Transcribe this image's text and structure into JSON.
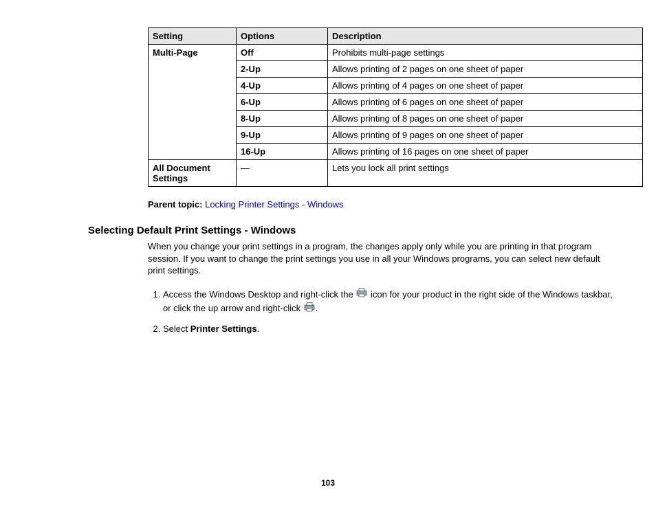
{
  "table": {
    "headers": [
      "Setting",
      "Options",
      "Description"
    ],
    "rows": [
      {
        "setting": "Multi-Page",
        "option": "Off",
        "desc": "Prohibits multi-page settings"
      },
      {
        "setting": "",
        "option": "2-Up",
        "desc": "Allows printing of 2 pages on one sheet of paper"
      },
      {
        "setting": "",
        "option": "4-Up",
        "desc": "Allows printing of 4 pages on one sheet of paper"
      },
      {
        "setting": "",
        "option": "6-Up",
        "desc": "Allows printing of 6 pages on one sheet of paper"
      },
      {
        "setting": "",
        "option": "8-Up",
        "desc": "Allows printing of 8 pages on one sheet of paper"
      },
      {
        "setting": "",
        "option": "9-Up",
        "desc": "Allows printing of 9 pages on one sheet of paper"
      },
      {
        "setting": "",
        "option": "16-Up",
        "desc": "Allows printing of 16 pages on one sheet of paper"
      },
      {
        "setting": "All Document Settings",
        "option": "—",
        "desc": "Lets you lock all print settings"
      }
    ]
  },
  "parent_topic": {
    "label": "Parent topic:",
    "link": "Locking Printer Settings - Windows"
  },
  "heading": "Selecting Default Print Settings - Windows",
  "intro": "When you change your print settings in a program, the changes apply only while you are printing in that program session. If you want to change the print settings you use in all your Windows programs, you can select new default print settings.",
  "steps": {
    "s1a": "Access the Windows Desktop and right-click the ",
    "s1b": " icon for your product in the right side of the Windows taskbar, or click the up arrow and right-click ",
    "s1c": ".",
    "s2a": "Select ",
    "s2b": "Printer Settings",
    "s2c": "."
  },
  "page_number": "103"
}
